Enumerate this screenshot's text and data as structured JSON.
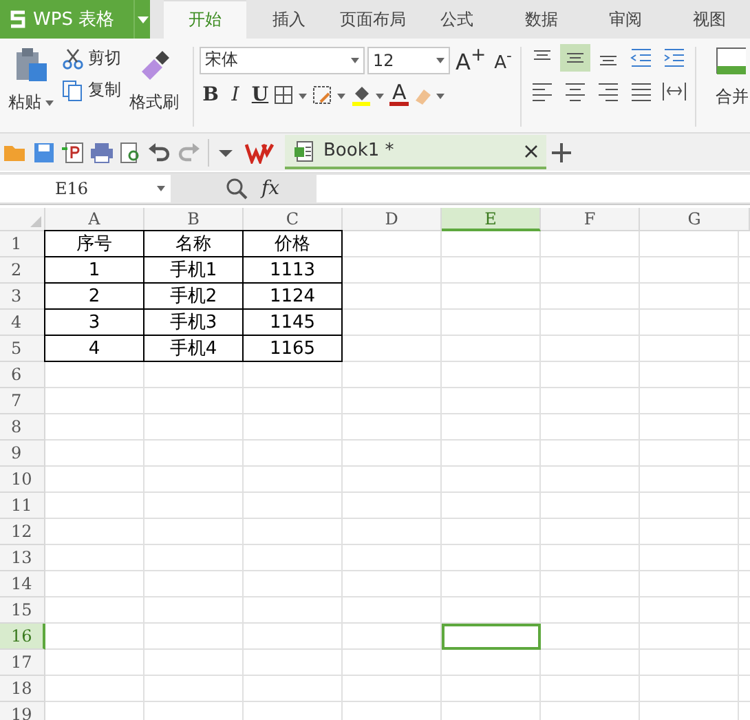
{
  "app_menu": {
    "label": "WPS 表格"
  },
  "tabs": [
    {
      "label": "开始",
      "selected": true
    },
    {
      "label": "插入",
      "selected": false
    },
    {
      "label": "页面布局",
      "selected": false
    },
    {
      "label": "公式",
      "selected": false
    },
    {
      "label": "数据",
      "selected": false
    },
    {
      "label": "审阅",
      "selected": false
    },
    {
      "label": "视图",
      "selected": false
    }
  ],
  "ribbon": {
    "paste": "粘贴",
    "cut": "剪切",
    "copy": "复制",
    "format_painter": "格式刷",
    "font_name": "宋体",
    "font_size": "12",
    "font_grow": "A$^{+}$",
    "font_shrink": "A$^{-}$",
    "bold": "B",
    "italic": "I",
    "underline": "U",
    "font_color": "A",
    "align_buttons": [
      {
        "selected": false
      },
      {
        "selected": true
      },
      {
        "selected": false
      }
    ],
    "merge": "合并"
  },
  "document_tab": {
    "title": "Book1 *"
  },
  "formula_bar": {
    "name_box": "E16",
    "fx": "fx"
  },
  "sheet": {
    "columns": [
      {
        "label": "A",
        "selected": false
      },
      {
        "label": "B",
        "selected": false
      },
      {
        "label": "C",
        "selected": false
      },
      {
        "label": "D",
        "selected": false
      },
      {
        "label": "E",
        "selected": true
      },
      {
        "label": "F",
        "selected": false
      },
      {
        "label": "G",
        "selected": false
      }
    ],
    "rows": [
      {
        "label": "1",
        "selected": false,
        "cells": [
          "序号",
          "名称",
          "价格"
        ]
      },
      {
        "label": "2",
        "selected": false,
        "cells": [
          "1",
          "手机1",
          "1113"
        ]
      },
      {
        "label": "3",
        "selected": false,
        "cells": [
          "2",
          "手机2",
          "1124"
        ]
      },
      {
        "label": "4",
        "selected": false,
        "cells": [
          "3",
          "手机3",
          "1145"
        ]
      },
      {
        "label": "5",
        "selected": false,
        "cells": [
          "4",
          "手机4",
          "1165"
        ]
      },
      {
        "label": "6",
        "selected": false
      },
      {
        "label": "7",
        "selected": false
      },
      {
        "label": "8",
        "selected": false
      },
      {
        "label": "9",
        "selected": false
      },
      {
        "label": "10",
        "selected": false
      },
      {
        "label": "11",
        "selected": false
      },
      {
        "label": "12",
        "selected": false
      },
      {
        "label": "13",
        "selected": false
      },
      {
        "label": "14",
        "selected": false
      },
      {
        "label": "15",
        "selected": false
      },
      {
        "label": "16",
        "selected": true
      },
      {
        "label": "17",
        "selected": false
      },
      {
        "label": "18",
        "selected": false
      },
      {
        "label": "19",
        "selected": false
      }
    ]
  }
}
